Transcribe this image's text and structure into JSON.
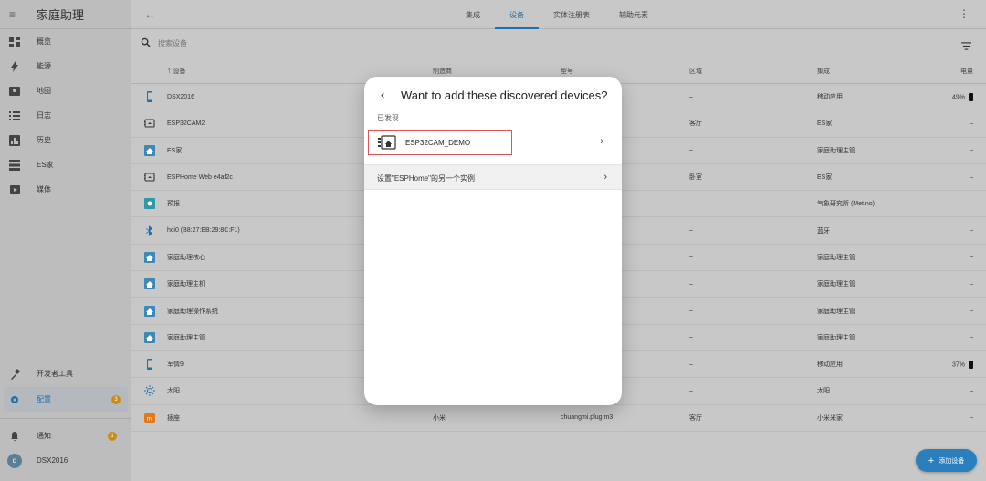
{
  "app": {
    "title": "家庭助理"
  },
  "sidebar": {
    "items": [
      {
        "label": "概览",
        "icon": "dashboard-icon"
      },
      {
        "label": "能源",
        "icon": "lightning-icon"
      },
      {
        "label": "地图",
        "icon": "map-icon"
      },
      {
        "label": "日志",
        "icon": "list-icon"
      },
      {
        "label": "历史",
        "icon": "chart-icon"
      },
      {
        "label": "ES家",
        "icon": "es-icon"
      },
      {
        "label": "媒体",
        "icon": "media-icon"
      }
    ],
    "dev_tools": "开发者工具",
    "config": "配置",
    "config_badge": "3",
    "notifications": "通知",
    "notifications_badge": "1",
    "user_initial": "d",
    "user_name": "DSX2016"
  },
  "topbar": {
    "tabs": [
      "集成",
      "设备",
      "实体注册表",
      "辅助元素"
    ],
    "active_tab": "设备"
  },
  "search": {
    "placeholder": "搜索设备"
  },
  "table": {
    "headers": {
      "name": "设备",
      "maker": "制造商",
      "model": "型号",
      "area": "区域",
      "integration": "集成",
      "battery": "电量"
    },
    "rows": [
      {
        "name": "DSX2016",
        "area": "–",
        "integration": "移动应用",
        "battery": "49%",
        "icon": "phone-icon"
      },
      {
        "name": "ESP32CAM2",
        "area": "客厅",
        "integration": "ES家",
        "battery": "–",
        "icon": "camera-icon"
      },
      {
        "name": "ES家",
        "area": "–",
        "integration": "家庭助理主管",
        "battery": "–",
        "icon": "home-icon"
      },
      {
        "name": "ESPHome Web e4af2c",
        "area": "卧室",
        "integration": "ES家",
        "battery": "–",
        "icon": "camera-icon"
      },
      {
        "name": "预报",
        "area": "–",
        "integration": "气象研究所 (Met.no)",
        "battery": "–",
        "icon": "weather-icon"
      },
      {
        "name": "hci0 (B8:27:EB:29:8C:F1)",
        "area": "–",
        "integration": "蓝牙",
        "battery": "–",
        "icon": "bluetooth-icon"
      },
      {
        "name": "家庭助理核心",
        "area": "–",
        "integration": "家庭助理主管",
        "battery": "–",
        "icon": "home-icon"
      },
      {
        "name": "家庭助理主机",
        "area": "–",
        "integration": "家庭助理主管",
        "battery": "–",
        "icon": "home-icon"
      },
      {
        "name": "家庭助理操作系统",
        "area": "–",
        "integration": "家庭助理主管",
        "battery": "–",
        "icon": "home-icon"
      },
      {
        "name": "家庭助理主管",
        "area": "–",
        "integration": "家庭助理主管",
        "battery": "–",
        "icon": "home-icon"
      },
      {
        "name": "军情9",
        "area": "–",
        "integration": "移动应用",
        "battery": "37%",
        "icon": "phone-icon"
      },
      {
        "name": "太阳",
        "area": "–",
        "integration": "太阳",
        "battery": "–",
        "icon": "sun-icon"
      },
      {
        "name": "插座",
        "maker": "小米",
        "model": "chuangmi.plug.m3",
        "area": "客厅",
        "integration": "小米米家",
        "battery": "–",
        "icon": "xiaomi-icon"
      }
    ]
  },
  "fab": {
    "label": "添加设备"
  },
  "dialog": {
    "title": "Want to add these discovered devices?",
    "subtitle": "已发现",
    "discovered": "ESP32CAM_DEMO",
    "other": "设置\"ESPHome\"的另一个实例"
  },
  "colors": {
    "accent": "#1f6fa8",
    "badge": "#c88a1a",
    "highlight": "#e05555"
  }
}
